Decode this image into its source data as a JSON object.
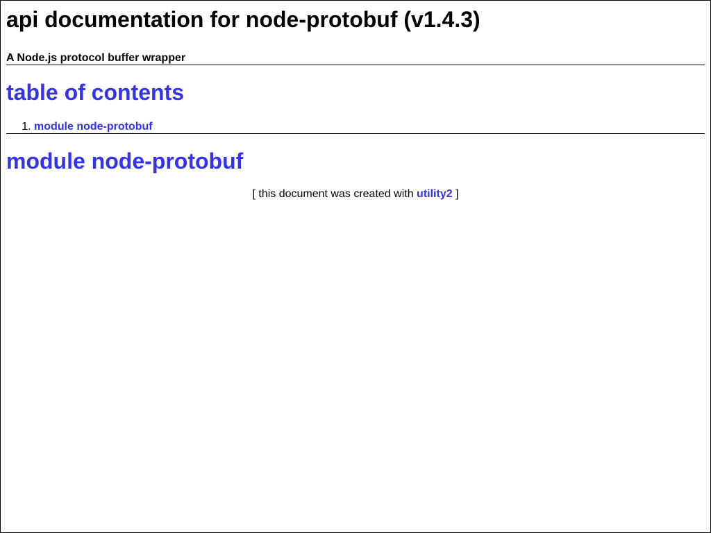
{
  "header": {
    "title": "api documentation for node-protobuf (v1.4.3)",
    "subtitle": "A Node.js protocol buffer wrapper"
  },
  "toc": {
    "heading": "table of contents",
    "items": [
      {
        "number": "1.",
        "label": "module node-protobuf"
      }
    ]
  },
  "module": {
    "heading": "module node-protobuf"
  },
  "footer": {
    "prefix": "[ this document was created with",
    "link_label": "utility2",
    "suffix": "]"
  },
  "colors": {
    "link": "#3333ee",
    "text": "#000000",
    "background": "#ffffff"
  }
}
